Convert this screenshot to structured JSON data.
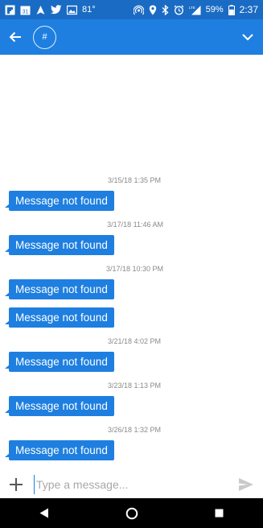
{
  "status_bar": {
    "temperature": "81°",
    "battery": "59%",
    "time": "2:37",
    "icons_left": [
      "flipboard-icon",
      "calendar-icon",
      "navigation-icon",
      "twitter-icon",
      "image-icon"
    ],
    "icons_right": [
      "hotspot-icon",
      "location-icon",
      "bluetooth-icon",
      "alarm-icon",
      "lte-signal-icon",
      "battery-icon"
    ],
    "calendar_day": "31",
    "lte_label": "LTE"
  },
  "app_bar": {
    "avatar_label": "#",
    "color": "#1e7fe0"
  },
  "messages": [
    {
      "timestamp": "3/15/18 1:35 PM",
      "text": "Message not found"
    },
    {
      "timestamp": "3/17/18 11:46 AM",
      "text": "Message not found"
    },
    {
      "timestamp": "3/17/18 10:30 PM",
      "text": "Message not found"
    },
    {
      "timestamp": "",
      "text": "Message not found"
    },
    {
      "timestamp": "3/21/18 4:02 PM",
      "text": "Message not found"
    },
    {
      "timestamp": "3/23/18 1:13 PM",
      "text": "Message not found"
    },
    {
      "timestamp": "3/26/18 1:32 PM",
      "text": "Message not found"
    }
  ],
  "composer": {
    "placeholder": "Type a message..."
  }
}
